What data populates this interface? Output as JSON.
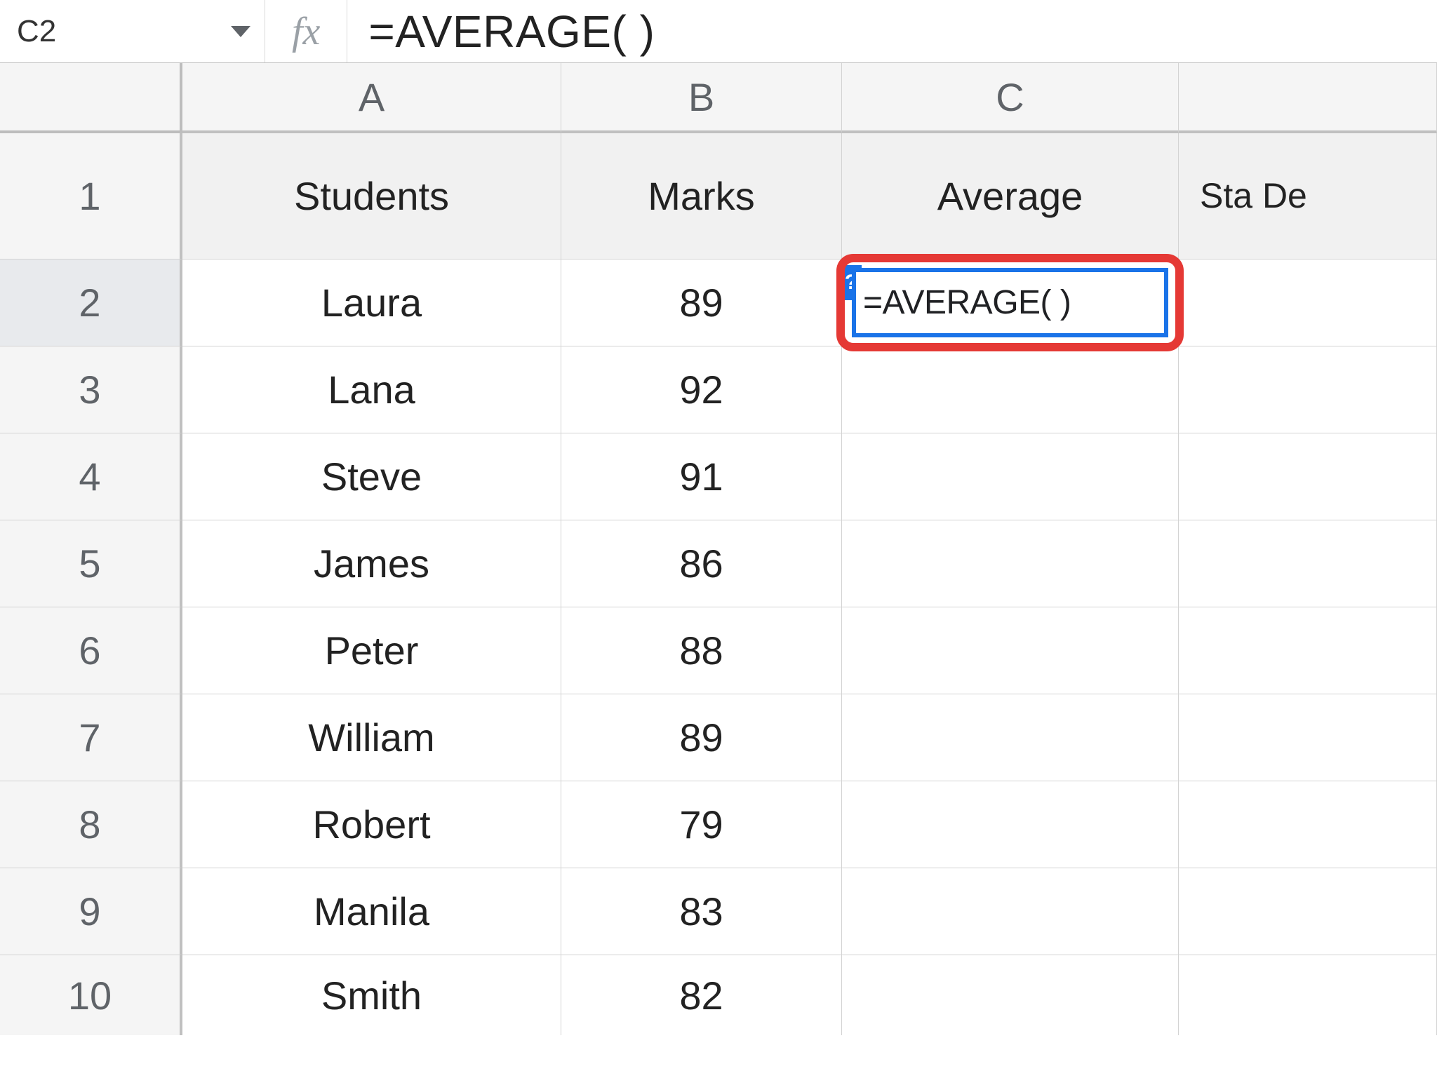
{
  "formula_bar": {
    "cell_ref": "C2",
    "fx_symbol": "fx",
    "formula": "=AVERAGE(    )"
  },
  "columns": {
    "A": "A",
    "B": "B",
    "C": "C",
    "D": ""
  },
  "headers": {
    "A": "Students",
    "B": "Marks",
    "C": "Average",
    "D": "Sta De"
  },
  "row_headers": [
    "1",
    "2",
    "3",
    "4",
    "5",
    "6",
    "7",
    "8",
    "9",
    "10"
  ],
  "rows": [
    {
      "A": "Laura",
      "B": "89"
    },
    {
      "A": "Lana",
      "B": "92"
    },
    {
      "A": "Steve",
      "B": "91"
    },
    {
      "A": "James",
      "B": "86"
    },
    {
      "A": "Peter",
      "B": "88"
    },
    {
      "A": "William",
      "B": "89"
    },
    {
      "A": "Robert",
      "B": "79"
    },
    {
      "A": "Manila",
      "B": "83"
    },
    {
      "A": "Smith",
      "B": "82"
    }
  ],
  "editing_cell": {
    "help_badge": "?",
    "formula": "=AVERAGE(   )"
  }
}
